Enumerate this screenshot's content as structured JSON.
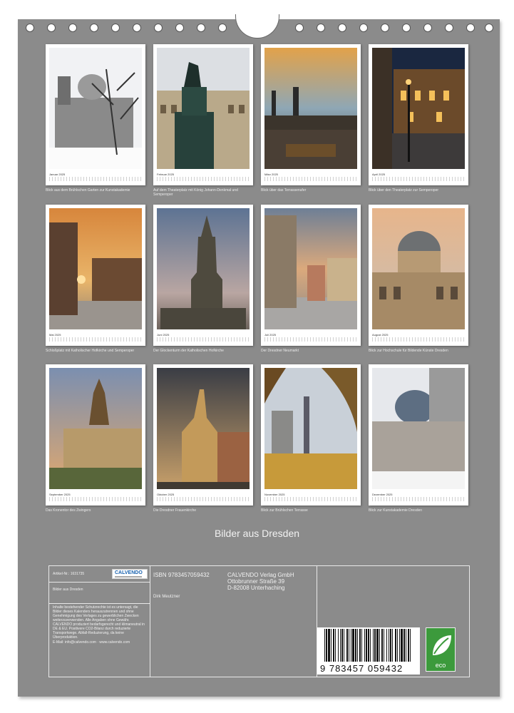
{
  "calendar_title": "Bilder aus Dresden",
  "months": [
    {
      "month": "Januar 2025",
      "caption": "Blick aus dem Brühlschen Garten zur Kunstakademie"
    },
    {
      "month": "Februar 2025",
      "caption": "Auf dem Theaterplatz mit König Johann-Denkmal und Semperoper"
    },
    {
      "month": "März 2025",
      "caption": "Blick über das Terrassenufer"
    },
    {
      "month": "April 2025",
      "caption": "Blick über den Theaterplatz zur Semperoper"
    },
    {
      "month": "Mai 2025",
      "caption": "Schloßplatz mit Katholischer Hofkirche und Semperoper"
    },
    {
      "month": "Juni 2025",
      "caption": "Der Glockenturm der Katholischen Hofkirche"
    },
    {
      "month": "Juli 2025",
      "caption": "Der Dresdner Neumarkt"
    },
    {
      "month": "August 2025",
      "caption": "Blick zur Hochschule für Bildende Künste Dresden"
    },
    {
      "month": "September 2025",
      "caption": "Das Kronentor des Zwingers"
    },
    {
      "month": "Oktober 2025",
      "caption": "Die Dresdner Frauenkirche"
    },
    {
      "month": "November 2025",
      "caption": "Blick zur Brühlschen Terrasse"
    },
    {
      "month": "Dezember 2025",
      "caption": "Blick zur Kunstakademie Dresden"
    }
  ],
  "info": {
    "article_label": "Artikel-Nr.: 1631735",
    "calendar_name": "Bilder aus Dresden",
    "logo_text": "CALVENDO",
    "isbn": "ISBN 9783457059432",
    "author": "Dirk Meutzner",
    "publisher_lines": [
      "CALVENDO Verlag GmbH",
      "Ottobrunner Straße 39",
      "D-82008 Unterhaching"
    ],
    "legal_text": "Inhalte bestehender Schutzrechte ist es untersagt, die Bilder dieses Kalenders herauszutrennen und ohne Genehmigung des Verlages zu gewerblichen Zwecken weiterzuverwenden. Alle Angaben ohne Gewähr. CALVENDO produziert bedarfsgerecht und klimaneutral in DE & EU. Positivere CO2-Bilanz durch reduzierte Transportwege. Abfall-Reduzierung, da keine Überproduktion.",
    "contact": "E-Mail: info@calvendo.com · www.calvendo.com",
    "barcode_number": "9 783457 059432",
    "eco_label": "eco"
  },
  "colors": {
    "sheet": "#8b8b8b",
    "eco_green": "#3c9a3c"
  }
}
